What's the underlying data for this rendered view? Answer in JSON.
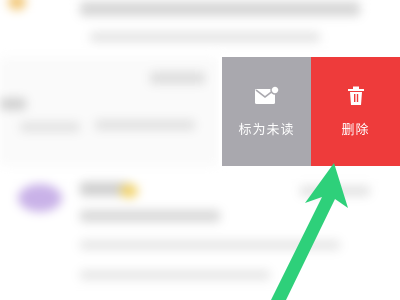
{
  "swipe_actions": {
    "mark_unread": {
      "label": "标为未读",
      "icon": "mail-unread-icon",
      "color": "#a9a8ae"
    },
    "delete": {
      "label": "删除",
      "icon": "trash-icon",
      "color": "#ee3b3b"
    }
  },
  "annotation": {
    "arrow_color": "#2ed07a"
  }
}
